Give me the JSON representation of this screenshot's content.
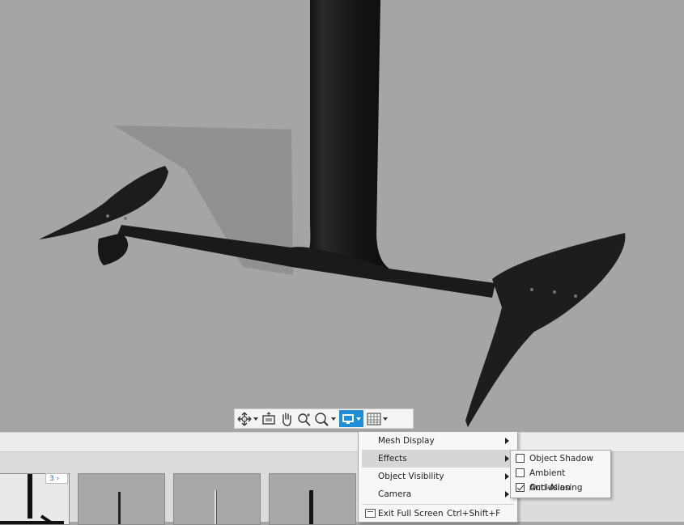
{
  "viewport": {
    "background": "#a5a5a3",
    "model_color": "#1b1b1b"
  },
  "toolbar": {
    "buttons": [
      {
        "icon": "orbit-icon",
        "has_dropdown": true
      },
      {
        "icon": "fit-view-icon",
        "has_dropdown": false
      },
      {
        "icon": "pan-hand-icon",
        "has_dropdown": false
      },
      {
        "icon": "zoom-icon",
        "has_dropdown": false
      },
      {
        "icon": "zoom-window-icon",
        "has_dropdown": true
      },
      {
        "icon": "display-monitor-icon",
        "has_dropdown": true,
        "active": true
      },
      {
        "icon": "grid-icon",
        "has_dropdown": true
      }
    ],
    "accent": "#1e8fd6"
  },
  "filmstrip": {
    "badge": "3 ›"
  },
  "menu": {
    "items": [
      {
        "label": "Mesh Display",
        "submenu": true
      },
      {
        "label": "Effects",
        "submenu": true,
        "highlighted": true
      },
      {
        "label": "Object Visibility",
        "submenu": true
      },
      {
        "label": "Camera",
        "submenu": true
      }
    ],
    "exit": {
      "label": "Exit Full Screen",
      "shortcut": "Ctrl+Shift+F"
    }
  },
  "submenu": {
    "items": [
      {
        "label": "Object Shadow",
        "checked": false
      },
      {
        "label": "Ambient Occlusion",
        "checked": false
      },
      {
        "label": "Anti-Aliasing",
        "checked": true
      }
    ]
  }
}
